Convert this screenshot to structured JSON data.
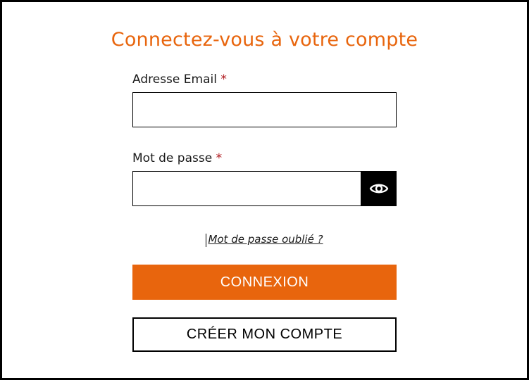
{
  "login": {
    "title": "Connectez-vous à votre compte",
    "email": {
      "label": "Adresse Email",
      "required_mark": "*",
      "value": "",
      "placeholder": ""
    },
    "password": {
      "label": "Mot de passe",
      "required_mark": "*",
      "value": "",
      "placeholder": "",
      "toggle_icon": "eye-icon"
    },
    "forgot_password_label": "Mot de passe oublié ?",
    "submit_label": "CONNEXION",
    "create_account_label": "CRÉER MON COMPTE"
  },
  "colors": {
    "accent": "#e8650d",
    "required": "#b0191e",
    "border": "#000000"
  }
}
